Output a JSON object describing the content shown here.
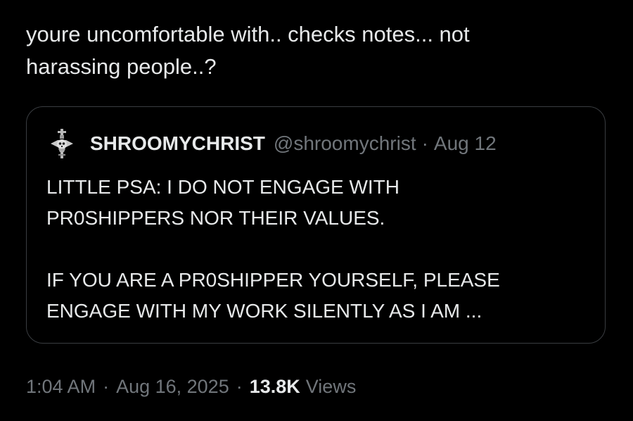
{
  "tweet": {
    "text_line1": "youre uncomfortable with.. checks notes... not",
    "text_line2": "harassing people..?"
  },
  "quote": {
    "display_name": "SHROOMYCHRIST",
    "handle": "@shroomychrist",
    "separator": "·",
    "date": "Aug 12",
    "avatar_icon": "cross-skull-avatar-icon",
    "body_line1": "LITTLE PSA: I DO NOT ENGAGE WITH",
    "body_line2": "PR0SHIPPERS NOR THEIR VALUES.",
    "body_line3": "IF YOU ARE A PR0SHIPPER YOURSELF, PLEASE",
    "body_line4": "ENGAGE WITH MY WORK SILENTLY AS I AM ..."
  },
  "meta": {
    "time": "1:04 AM",
    "sep1": "·",
    "date": "Aug 16, 2025",
    "sep2": "·",
    "views_count": "13.8K",
    "views_label": "Views"
  },
  "colors": {
    "background": "#000000",
    "text_primary": "#e7e9ea",
    "text_secondary": "#71767b",
    "border": "#3a3d41"
  }
}
